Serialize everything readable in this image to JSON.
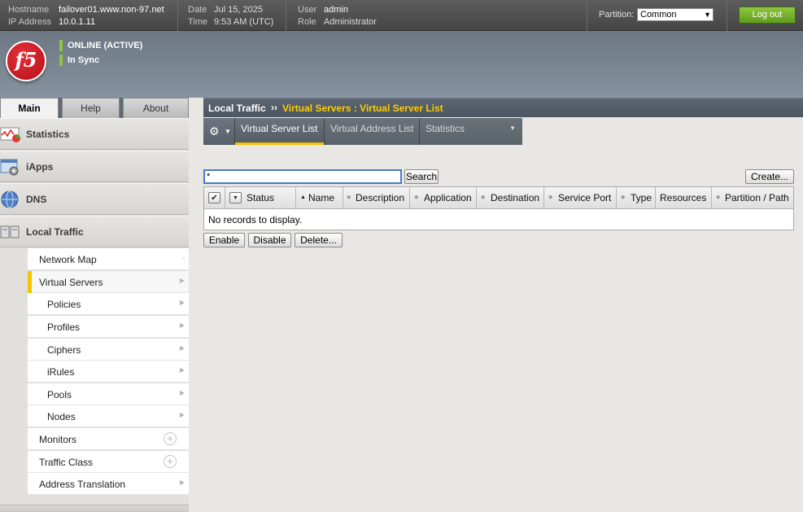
{
  "topbar": {
    "hostname_label": "Hostname",
    "hostname": "failover01.www.non-97.net",
    "ip_label": "IP Address",
    "ip": "10.0.1.11",
    "date_label": "Date",
    "date": "Jul 15, 2025",
    "time_label": "Time",
    "time": "9:53 AM (UTC)",
    "user_label": "User",
    "user": "admin",
    "role_label": "Role",
    "role": "Administrator",
    "partition_label": "Partition:",
    "partition_value": "Common",
    "logout_label": "Log out"
  },
  "banner": {
    "logo_text": "f5",
    "status": "ONLINE (ACTIVE)",
    "sync": "In Sync",
    "status_color": "#8dc63f"
  },
  "nav_tabs": [
    {
      "label": "Main",
      "active": true
    },
    {
      "label": "Help",
      "active": false
    },
    {
      "label": "About",
      "active": false
    }
  ],
  "nav_sections": [
    {
      "label": "Statistics",
      "icon": "statistics-chart-icon"
    },
    {
      "label": "iApps",
      "icon": "iapps-gear-icon"
    },
    {
      "label": "DNS",
      "icon": "globe-icon"
    },
    {
      "label": "Local Traffic",
      "icon": "local-traffic-icon"
    }
  ],
  "nav_items": [
    {
      "label": "Network Map",
      "indent": 1,
      "marker": "map"
    },
    {
      "label": "Virtual Servers",
      "indent": 1,
      "marker": "chevron",
      "active": true
    },
    {
      "label": "Policies",
      "indent": 2,
      "marker": "chevron"
    },
    {
      "label": "Profiles",
      "indent": 2,
      "marker": "chevron"
    },
    {
      "label": "Ciphers",
      "indent": 2,
      "marker": "chevron"
    },
    {
      "label": "iRules",
      "indent": 2,
      "marker": "chevron"
    },
    {
      "label": "Pools",
      "indent": 2,
      "marker": "chevron"
    },
    {
      "label": "Nodes",
      "indent": 2,
      "marker": "chevron"
    },
    {
      "label": "Monitors",
      "indent": 1,
      "marker": "plus"
    },
    {
      "label": "Traffic Class",
      "indent": 1,
      "marker": "plus"
    },
    {
      "label": "Address Translation",
      "indent": 1,
      "marker": "chevron"
    }
  ],
  "breadcrumb": {
    "section": "Local Traffic",
    "separator": "››",
    "current": "Virtual Servers : Virtual Server List"
  },
  "subtabs": [
    {
      "label": "Virtual Server List",
      "active": true
    },
    {
      "label": "Virtual Address List",
      "active": false
    },
    {
      "label": "Statistics",
      "active": false,
      "dropdown": true
    }
  ],
  "search": {
    "value": "*",
    "button": "Search",
    "create_button": "Create..."
  },
  "table": {
    "columns": [
      "Status",
      "Name",
      "Description",
      "Application",
      "Destination",
      "Service Port",
      "Type",
      "Resources",
      "Partition / Path"
    ],
    "sorted_column": "Name",
    "empty_text": "No records to display."
  },
  "actions": {
    "enable": "Enable",
    "disable": "Disable",
    "delete": "Delete..."
  }
}
